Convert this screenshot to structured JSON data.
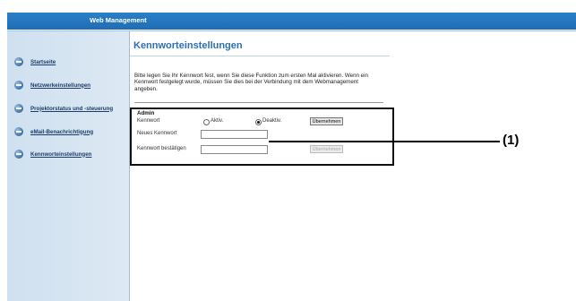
{
  "header": {
    "title": "Web Management"
  },
  "sidebar": {
    "items": [
      {
        "label": "Startseite"
      },
      {
        "label": "Netzwerkeinstellungen"
      },
      {
        "label": "Projektorstatus und -steuerung"
      },
      {
        "label": "eMail-Benachrichtigung"
      },
      {
        "label": "Kennworteinstellungen"
      }
    ]
  },
  "main": {
    "title": "Kennworteinstellungen",
    "intro": "Bitte legen Sie Ihr Kennwort fest, wenn Sie diese Funktion zum ersten Mal aktivieren. Wenn ein Kennwort festgelegt wurde, müssen Sie dies bei der Verbindung mit dem Webmanagement angeben.",
    "admin": {
      "section_title": "Admin",
      "password_label": "Kennwort",
      "radio_active_label": "Aktiv.",
      "radio_inactive_label": "Deaktiv.",
      "radio_selected": "Deaktiv.",
      "apply_button": "Übernehmen",
      "new_password_label": "Neues Kennwort",
      "new_password_value": "",
      "confirm_password_label": "Kennwort bestätigen",
      "confirm_password_value": "",
      "confirm_apply_button": "Übernehmen"
    }
  },
  "annotation": {
    "callout_label": "(1)"
  }
}
